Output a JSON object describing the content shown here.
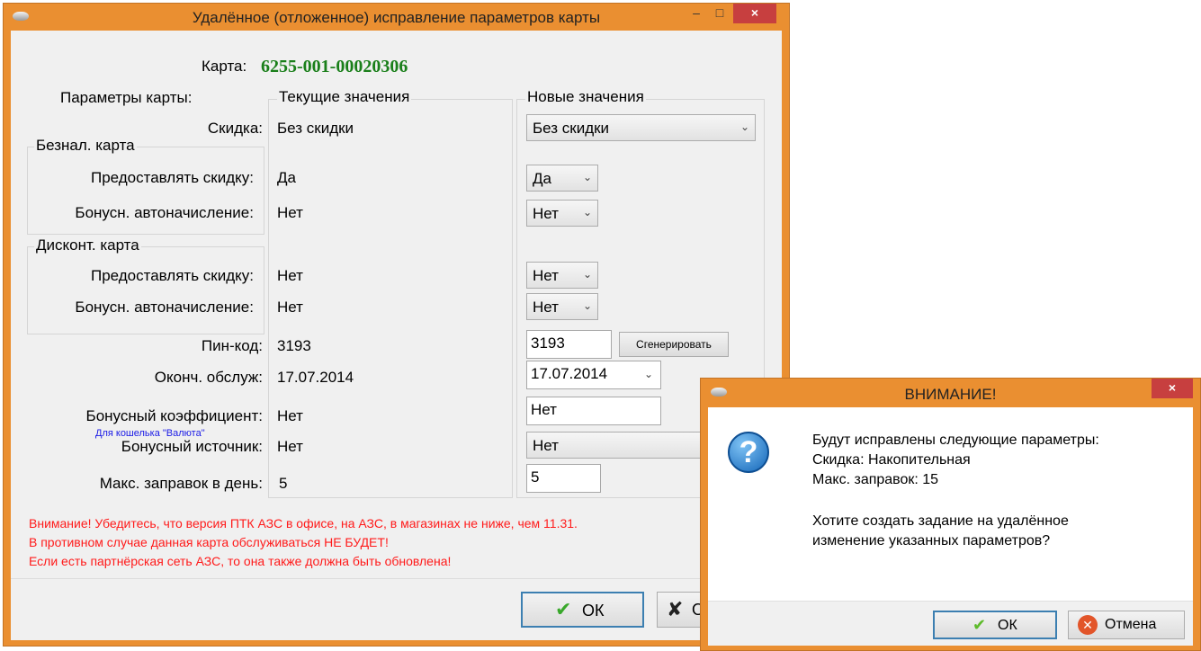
{
  "main": {
    "title": "Удалённое (отложенное) исправление параметров карты",
    "minimize": "–",
    "maximize": "□",
    "close": "×",
    "card_label": "Карта:",
    "card_number": "6255-001-00020306",
    "col_params": "Параметры карты:",
    "col_current": "Текущие значения",
    "col_new": "Новые значения",
    "discount_label": "Скидка:",
    "discount_current": "Без скидки",
    "discount_new": "Без скидки",
    "cashless_group": "Безнал. карта",
    "discount_card_group": "Дисконт. карта",
    "provide_discount_label": "Предоставлять скидку:",
    "bonus_auto_label": "Бонусн. автоначисление:",
    "cashless_provide_current": "Да",
    "cashless_provide_new": "Да",
    "cashless_bonus_current": "Нет",
    "cashless_bonus_new": "Нет",
    "discount_provide_current": "Нет",
    "discount_provide_new": "Нет",
    "discount_bonus_current": "Нет",
    "discount_bonus_new": "Нет",
    "pin_label": "Пин-код:",
    "pin_current": "3193",
    "pin_new": "3193",
    "generate_button": "Сгенерировать",
    "service_end_label": "Оконч. обслуж:",
    "service_end_current": "17.07.2014",
    "service_end_new": "17.07.2014",
    "bonus_coef_label": "Бонусный коэффициент:",
    "bonus_coef_current": "Нет",
    "bonus_coef_new": "Нет",
    "wallet_hint": "Для кошелька \"Валюта\"",
    "bonus_source_label": "Бонусный источник:",
    "bonus_source_current": "Нет",
    "bonus_source_new": "Нет",
    "max_fuel_label": "Макс. заправок в день:",
    "max_fuel_current": "5",
    "max_fuel_new": "5",
    "warning_lines": [
      "Внимание! Убедитесь, что версия ПТК АЗС в офисе, на АЗС, в магазинах не ниже, чем 11.31.",
      "В противном случае данная карта обслуживаться НЕ БУДЕТ!",
      "Если есть партнёрская сеть АЗС, то она также должна быть обновлена!"
    ],
    "ok_button": "ОК",
    "cancel_partial": "О"
  },
  "dialog": {
    "title": "ВНИМАНИЕ!",
    "close": "×",
    "lines": [
      "Будут исправлены следующие параметры:",
      "Скидка: Накопительная",
      "Макс. заправок: 15",
      "",
      "Хотите создать задание на удалённое",
      "изменение указанных параметров?"
    ],
    "ok_button": "ОК",
    "cancel_button": "Отмена"
  },
  "colors": {
    "frame": "#ea8f31",
    "card_number": "#1a7f1a",
    "warning": "#ff1a1a",
    "hint": "#1a1ae6"
  }
}
